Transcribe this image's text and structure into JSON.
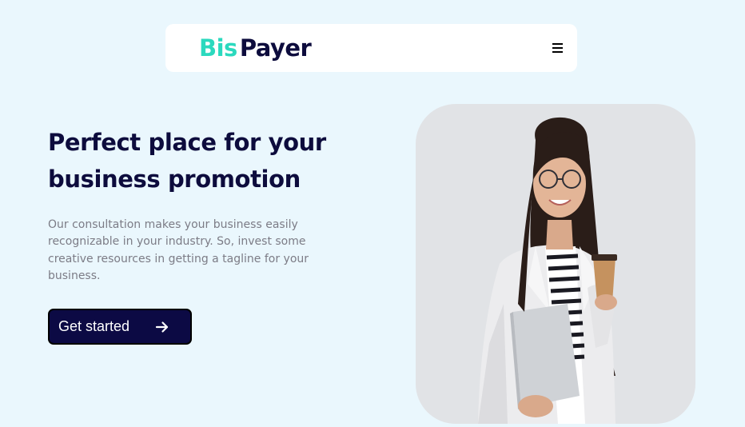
{
  "navbar": {
    "logo_part1": "Bis",
    "logo_part2": "Payer",
    "menu_icon": "hamburger-menu-icon"
  },
  "hero": {
    "title_lines": [
      "Perfect place for your",
      "business promotion"
    ],
    "description_lines": [
      "Our consultation makes your business easily",
      "recognizable in your industry. So, invest some",
      "creative resources in getting a tagline for your",
      "business."
    ],
    "cta_label": "Get started",
    "cta_icon": "arrow-right-icon",
    "image": "businesswoman-with-coffee-and-laptop"
  },
  "colors": {
    "page_bg": "#eaf7fd",
    "brand_teal": "#2bd9be",
    "brand_navy": "#0d0c3d",
    "button_bg": "#0c0a44",
    "body_text": "#7c7c86"
  }
}
